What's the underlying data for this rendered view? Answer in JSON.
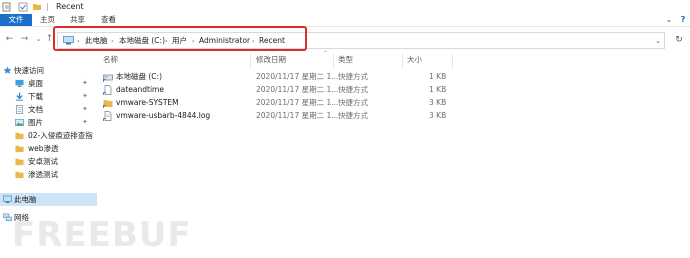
{
  "window": {
    "title": "Recent"
  },
  "ribbon": {
    "tabs": [
      "文件",
      "主页",
      "共享",
      "查看"
    ]
  },
  "address": {
    "crumbs": [
      "此电脑",
      "本地磁盘 (C:)",
      "用户",
      "Administrator",
      "Recent"
    ]
  },
  "sidebar": {
    "items": [
      {
        "label": "快速访问",
        "icon": "star-icon"
      },
      {
        "label": "桌面",
        "icon": "desktop-icon",
        "pinned": true
      },
      {
        "label": "下载",
        "icon": "download-icon",
        "pinned": true
      },
      {
        "label": "文档",
        "icon": "document-icon",
        "pinned": true
      },
      {
        "label": "图片",
        "icon": "picture-icon",
        "pinned": true
      },
      {
        "label": "02-入侵痕迹排查指",
        "icon": "folder-icon"
      },
      {
        "label": "web渗透",
        "icon": "folder-icon"
      },
      {
        "label": "安卓测试",
        "icon": "folder-icon"
      },
      {
        "label": "渗透测试",
        "icon": "folder-icon"
      },
      {
        "label": "此电脑",
        "icon": "pc-icon",
        "selected": true
      },
      {
        "label": "网络",
        "icon": "network-icon"
      }
    ]
  },
  "columns": {
    "name": "名称",
    "modified": "修改日期",
    "type": "类型",
    "size": "大小"
  },
  "files": [
    {
      "name": "本地磁盘 (C:)",
      "modified": "2020/11/17 星期二 1...",
      "type": "快捷方式",
      "size": "1 KB",
      "icon": "drive-shortcut-icon"
    },
    {
      "name": "dateandtime",
      "modified": "2020/11/17 星期二 1...",
      "type": "快捷方式",
      "size": "1 KB",
      "icon": "file-shortcut-icon"
    },
    {
      "name": "vmware-SYSTEM",
      "modified": "2020/11/17 星期二 1...",
      "type": "快捷方式",
      "size": "3 KB",
      "icon": "folder-shortcut-icon"
    },
    {
      "name": "vmware-usbarb-4844.log",
      "modified": "2020/11/17 星期二 1...",
      "type": "快捷方式",
      "size": "3 KB",
      "icon": "log-shortcut-icon"
    }
  ],
  "watermark": "FREEBUF",
  "colors": {
    "accent": "#1a6fc9",
    "highlight": "#e02b2b",
    "folder": "#e8b84a",
    "selected": "#cce4f7"
  }
}
